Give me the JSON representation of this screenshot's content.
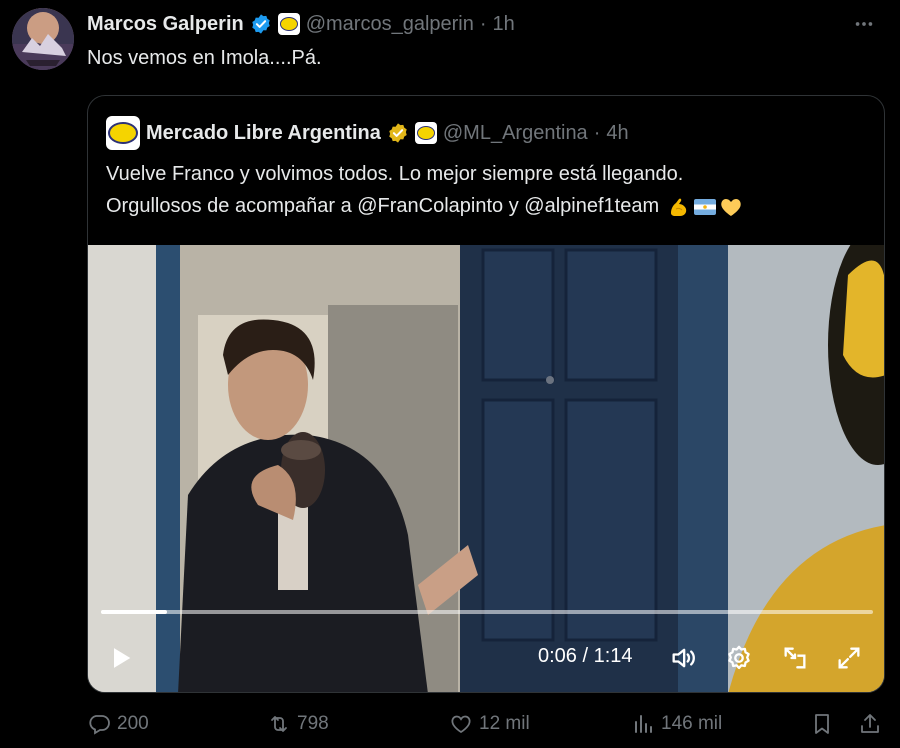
{
  "author": {
    "name": "Marcos Galperin",
    "handle": "@marcos_galperin",
    "time": "1h"
  },
  "tweet": {
    "text": "Nos vemos en Imola....Pá."
  },
  "quoted": {
    "name": "Mercado Libre Argentina",
    "handle": "@ML_Argentina",
    "time": "4h",
    "line1": "Vuelve Franco y volvimos todos. Lo mejor siempre está llegando.",
    "line2": "Orgullosos de acompañar a @FranColapinto y @alpinef1team",
    "emojis": [
      "flexed-biceps",
      "argentina-flag",
      "yellow-heart"
    ]
  },
  "video": {
    "current_time": "0:06",
    "separator": "/",
    "duration": "1:14",
    "progress": 0.085
  },
  "stats": {
    "replies": "200",
    "reposts": "798",
    "likes": "12 mil",
    "views": "146 mil"
  },
  "colors": {
    "background": "#000000",
    "text": "#e7e9ea",
    "muted": "#71767b",
    "verified_blue": "#1d9bf0",
    "verified_gold": "#e2b719",
    "border": "#2f3336"
  }
}
